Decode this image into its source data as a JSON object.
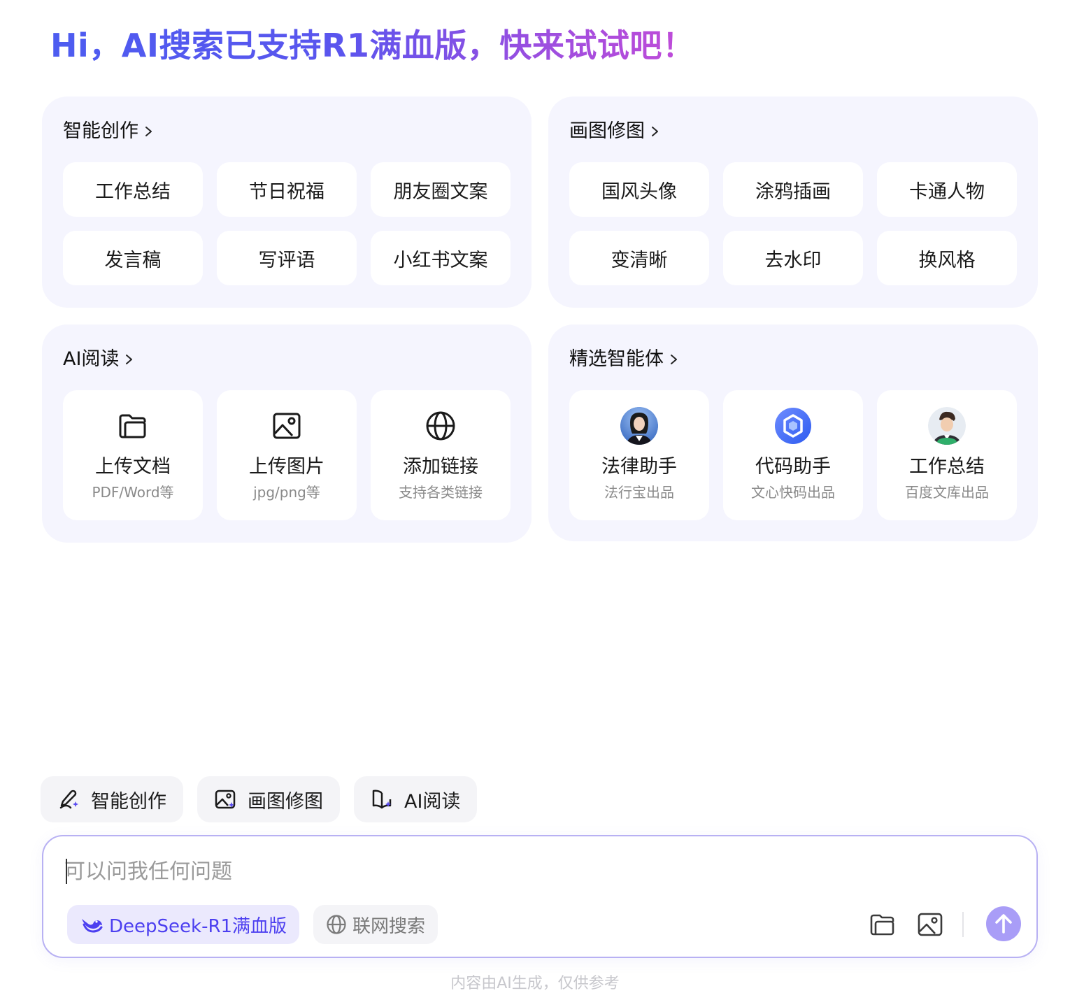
{
  "greeting": "Hi，AI搜索已支持R1满血版，快来试试吧！",
  "cards": {
    "creation": {
      "title": "智能创作",
      "items": [
        "工作总结",
        "节日祝福",
        "朋友圈文案",
        "发言稿",
        "写评语",
        "小红书文案"
      ]
    },
    "drawing": {
      "title": "画图修图",
      "items": [
        "国风头像",
        "涂鸦插画",
        "卡通人物",
        "变清晰",
        "去水印",
        "换风格"
      ]
    },
    "reading": {
      "title": "AI阅读",
      "tiles": [
        {
          "label": "上传文档",
          "sub": "PDF/Word等",
          "icon": "folder-icon"
        },
        {
          "label": "上传图片",
          "sub": "jpg/png等",
          "icon": "image-icon"
        },
        {
          "label": "添加链接",
          "sub": "支持各类链接",
          "icon": "globe-icon"
        }
      ]
    },
    "agents": {
      "title": "精选智能体",
      "tiles": [
        {
          "label": "法律助手",
          "sub": "法行宝出品",
          "icon": "lawyer-avatar"
        },
        {
          "label": "代码助手",
          "sub": "文心快码出品",
          "icon": "code-assistant-logo"
        },
        {
          "label": "工作总结",
          "sub": "百度文库出品",
          "icon": "businessman-avatar"
        }
      ]
    }
  },
  "chips": [
    "智能创作",
    "画图修图",
    "AI阅读"
  ],
  "input": {
    "placeholder": "可以问我任何问题",
    "model_label": "DeepSeek-R1满血版",
    "web_search_label": "联网搜索"
  },
  "footer": "内容由AI生成，仅供参考",
  "colors": {
    "accent": "#4c3ff0",
    "card_bg": "#f5f5fe",
    "input_border": "#b8b1f3",
    "send_button": "#a99df7"
  }
}
